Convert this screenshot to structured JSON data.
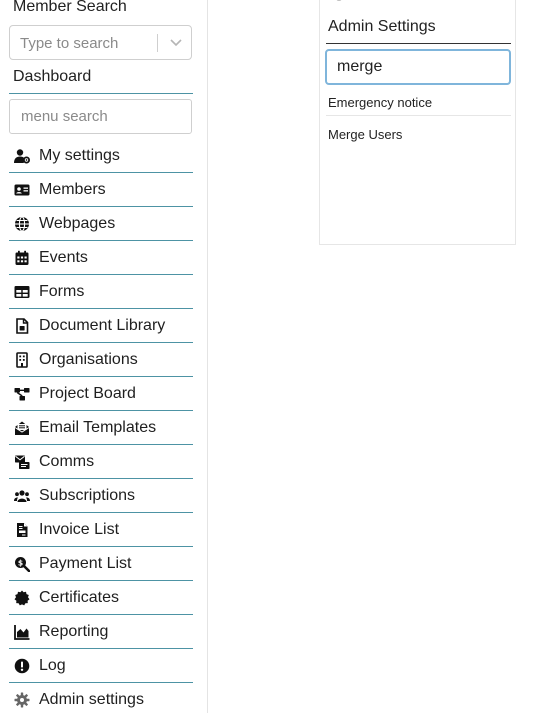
{
  "member_search": {
    "label": "Member Search",
    "placeholder": "Type to search"
  },
  "dashboard": {
    "label": "Dashboard"
  },
  "menu_search": {
    "placeholder": "menu search"
  },
  "nav": {
    "items": [
      {
        "label": "My settings",
        "icon": "user-gear-icon"
      },
      {
        "label": "Members",
        "icon": "id-card-icon"
      },
      {
        "label": "Webpages",
        "icon": "globe-icon"
      },
      {
        "label": "Events",
        "icon": "calendar-icon"
      },
      {
        "label": "Forms",
        "icon": "table-icon"
      },
      {
        "label": "Document Library",
        "icon": "document-icon"
      },
      {
        "label": "Organisations",
        "icon": "building-icon"
      },
      {
        "label": "Project Board",
        "icon": "sitemap-icon"
      },
      {
        "label": "Email Templates",
        "icon": "envelope-open-icon"
      },
      {
        "label": "Comms",
        "icon": "comms-icon"
      },
      {
        "label": "Subscriptions",
        "icon": "users-icon"
      },
      {
        "label": "Invoice List",
        "icon": "invoice-icon"
      },
      {
        "label": "Payment List",
        "icon": "search-dollar-icon"
      },
      {
        "label": "Certificates",
        "icon": "certificate-icon"
      },
      {
        "label": "Reporting",
        "icon": "chart-area-icon"
      },
      {
        "label": "Log",
        "icon": "exclamation-circle-icon"
      },
      {
        "label": "Admin settings",
        "icon": "gear-icon"
      }
    ]
  },
  "admin_panel": {
    "title": "Admin Settings",
    "search_value": "merge",
    "results": [
      {
        "label": "Emergency notice"
      },
      {
        "label": "Merge Users"
      }
    ]
  },
  "colors": {
    "divider": "#4d93a4",
    "focus_border": "#7fb5db"
  }
}
